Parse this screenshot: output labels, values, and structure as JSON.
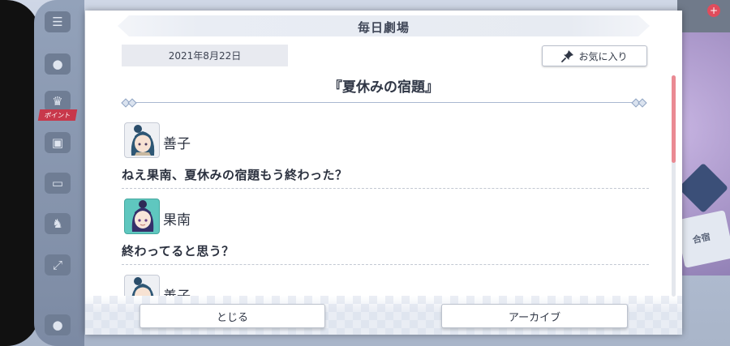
{
  "header": {
    "title": "毎日劇場"
  },
  "story": {
    "date": "2021年8月22日",
    "favorite_label": "お気に入り",
    "title": "『夏休みの宿題』"
  },
  "messages": [
    {
      "speaker": "善子",
      "text": "ねえ果南、夏休みの宿題もう終わった？"
    },
    {
      "speaker": "果南",
      "text": "終わってると思う？"
    },
    {
      "speaker": "善子",
      "text": ""
    }
  ],
  "footer": {
    "close_label": "とじる",
    "archive_label": "アーカイブ"
  },
  "background": {
    "side_badge": "ポイント",
    "card_label": "合宿"
  },
  "colors": {
    "scroll_thumb": "#ea8a93",
    "kanan_avatar_bg": "#5fc7bf"
  }
}
